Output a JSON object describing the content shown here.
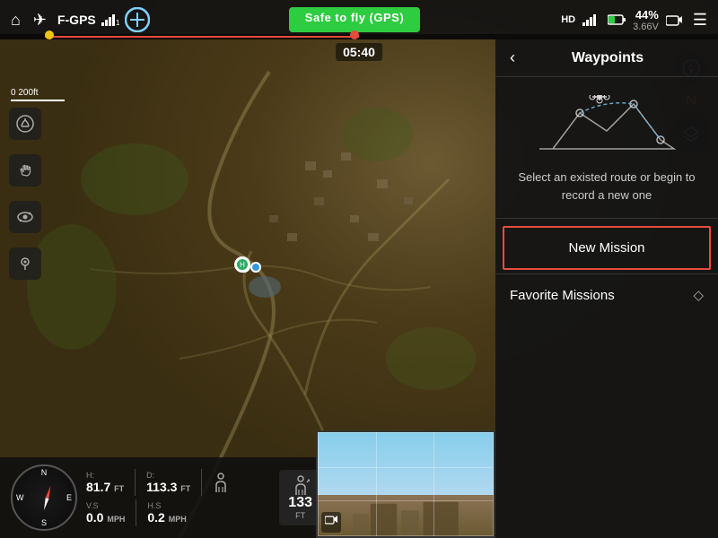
{
  "topbar": {
    "home_icon": "⌂",
    "drone_icon": "✈",
    "drone_id": "F-GPS",
    "signal_icon": "📶",
    "gps_status": "Safe to fly (GPS)",
    "hd_label": "HD",
    "video_signal": "📶",
    "battery_pct": "44%",
    "battery_volt": "3.66V",
    "menu_icon": "☰",
    "timer": "05:40"
  },
  "scale": {
    "label": "0    200ft"
  },
  "sidebar": {
    "icons": [
      "⬆",
      "✋",
      "↻",
      "📍"
    ]
  },
  "hud": {
    "h_label": "H:",
    "h_value": "81.7",
    "h_unit": "FT",
    "d_label": "D:",
    "d_value": "113.3",
    "d_unit": "FT",
    "vs_label": "V.S",
    "vs_value": "0.0",
    "vs_unit": "MPH",
    "hs_label": "H.S",
    "hs_value": "0.2",
    "hs_unit": "MPH",
    "alt_value": "133",
    "alt_unit": "FT"
  },
  "waypoints": {
    "title": "Waypoints",
    "back_label": "‹",
    "description": "Select an existed route or begin to record a new one",
    "new_mission_label": "New Mission",
    "favorite_missions_label": "Favorite Missions",
    "fav_icon": "◇"
  }
}
